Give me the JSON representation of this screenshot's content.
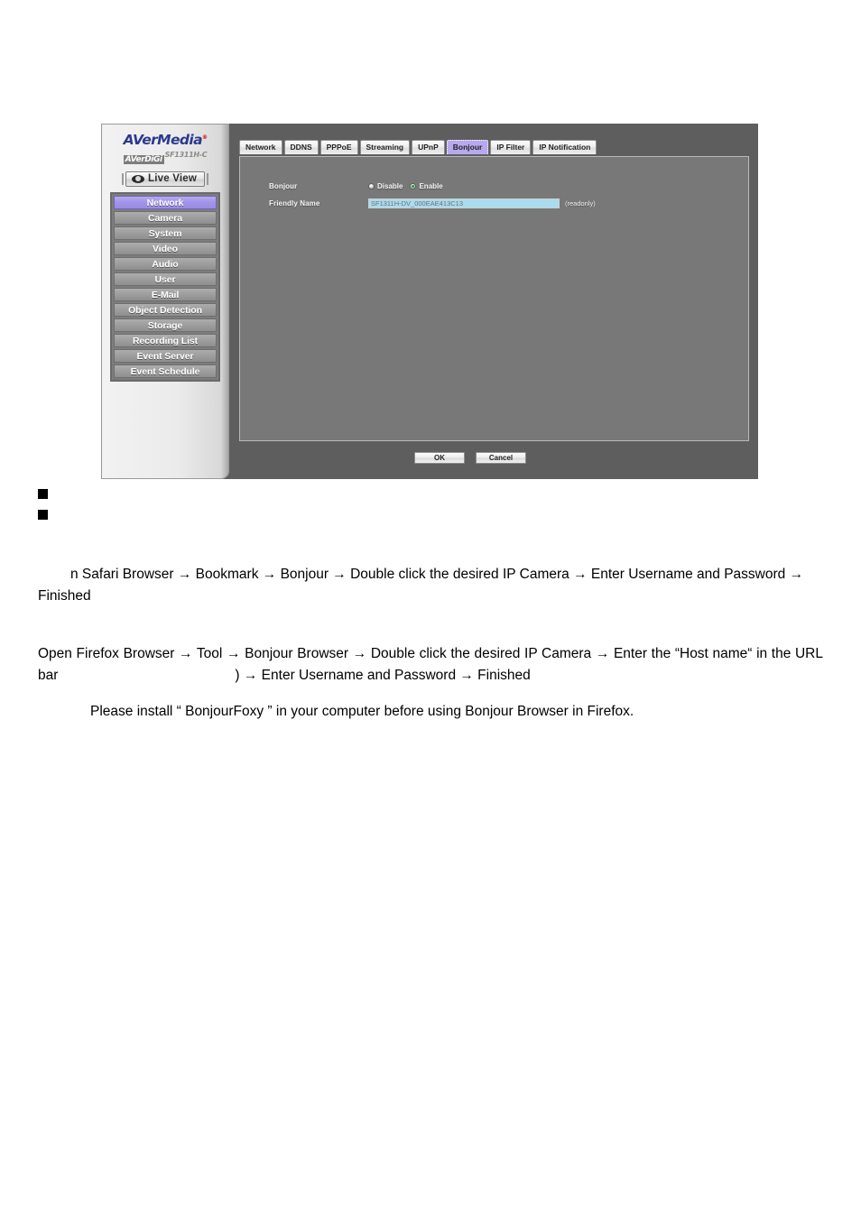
{
  "device_ui": {
    "brand": {
      "logo_main": "AVerMedia",
      "logo_reg": "®",
      "logo_digi": "AVerDiGi",
      "logo_model": "SF1311H-C"
    },
    "live_view_label": "Live View",
    "sidebar_items": [
      "Network",
      "Camera",
      "System",
      "Video",
      "Audio",
      "User",
      "E-Mail",
      "Object Detection",
      "Storage",
      "Recording List",
      "Event Server",
      "Event Schedule"
    ],
    "active_sidebar_item": "Network",
    "tabs": [
      "Network",
      "DDNS",
      "PPPoE",
      "Streaming",
      "UPnP",
      "Bonjour",
      "IP Filter",
      "IP Notification"
    ],
    "active_tab": "Bonjour",
    "form": {
      "bonjour_label": "Bonjour",
      "disable_label": "Disable",
      "enable_label": "Enable",
      "selected_option": "Enable",
      "friendly_name_label": "Friendly Name",
      "friendly_name_value": "SF1311H-DV_000EAE413C13",
      "readonly_note": "(readonly)"
    },
    "buttons": {
      "ok": "OK",
      "cancel": "Cancel"
    },
    "colors": {
      "header_gray": "#5e5e5e",
      "panel_gray": "#787878",
      "accent_purple": "#b8a9ee",
      "input_blue": "#a9dcef",
      "enable_green": "#13a03c"
    }
  },
  "document": {
    "paragraph_safari": "n Safari Browser → Bookmark → Bonjour → Double click the desired IP Camera → Enter Username and Password → Finished",
    "paragraph_firefox_part1": "Open Firefox Browser → Tool → Bonjour Browser → Double click the desired IP Camera → Enter the “Host  name“ in the URL bar",
    "paragraph_firefox_part2": ") → Enter Username and Password → Finished",
    "paragraph_note": "Please install “ BonjourFoxy ” in your computer before using Bonjour Browser in Firefox."
  }
}
